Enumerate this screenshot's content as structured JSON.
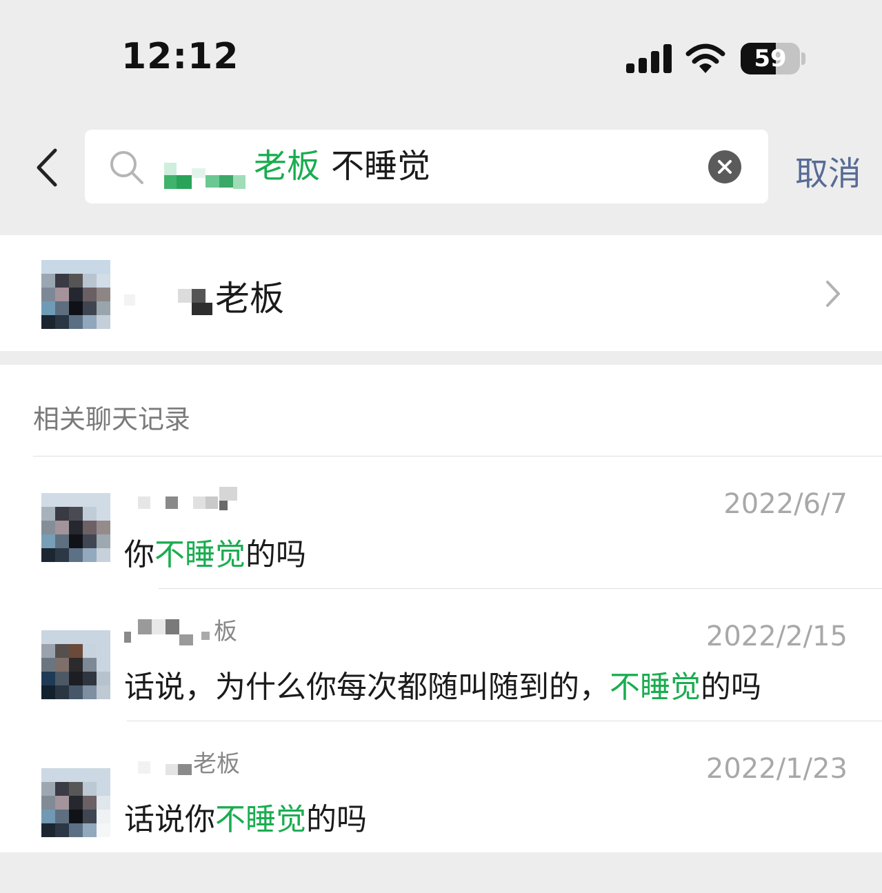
{
  "status_bar": {
    "time": "12:12",
    "battery": "59",
    "battery_level": 0.59
  },
  "search": {
    "query_highlight": "老板",
    "query_rest": "不睡觉",
    "cancel_label": "取消"
  },
  "contact": {
    "name_visible": "老板"
  },
  "records": {
    "title": "相关聊天记录",
    "items": [
      {
        "sender_visible": "",
        "date": "2022/6/7",
        "msg_before": "你",
        "msg_highlight": "不睡觉",
        "msg_after": "的吗"
      },
      {
        "sender_visible": "板",
        "date": "2022/2/15",
        "msg_before": "话说，为什么你每次都随叫随到的，",
        "msg_highlight": "不睡觉",
        "msg_after": "的吗"
      },
      {
        "sender_visible": "老板",
        "date": "2022/1/23",
        "msg_before": "话说你",
        "msg_highlight": "不睡觉",
        "msg_after": "的吗"
      }
    ]
  },
  "colors": {
    "highlight": "#1aad50",
    "link": "#576b95",
    "background": "#ededed"
  }
}
